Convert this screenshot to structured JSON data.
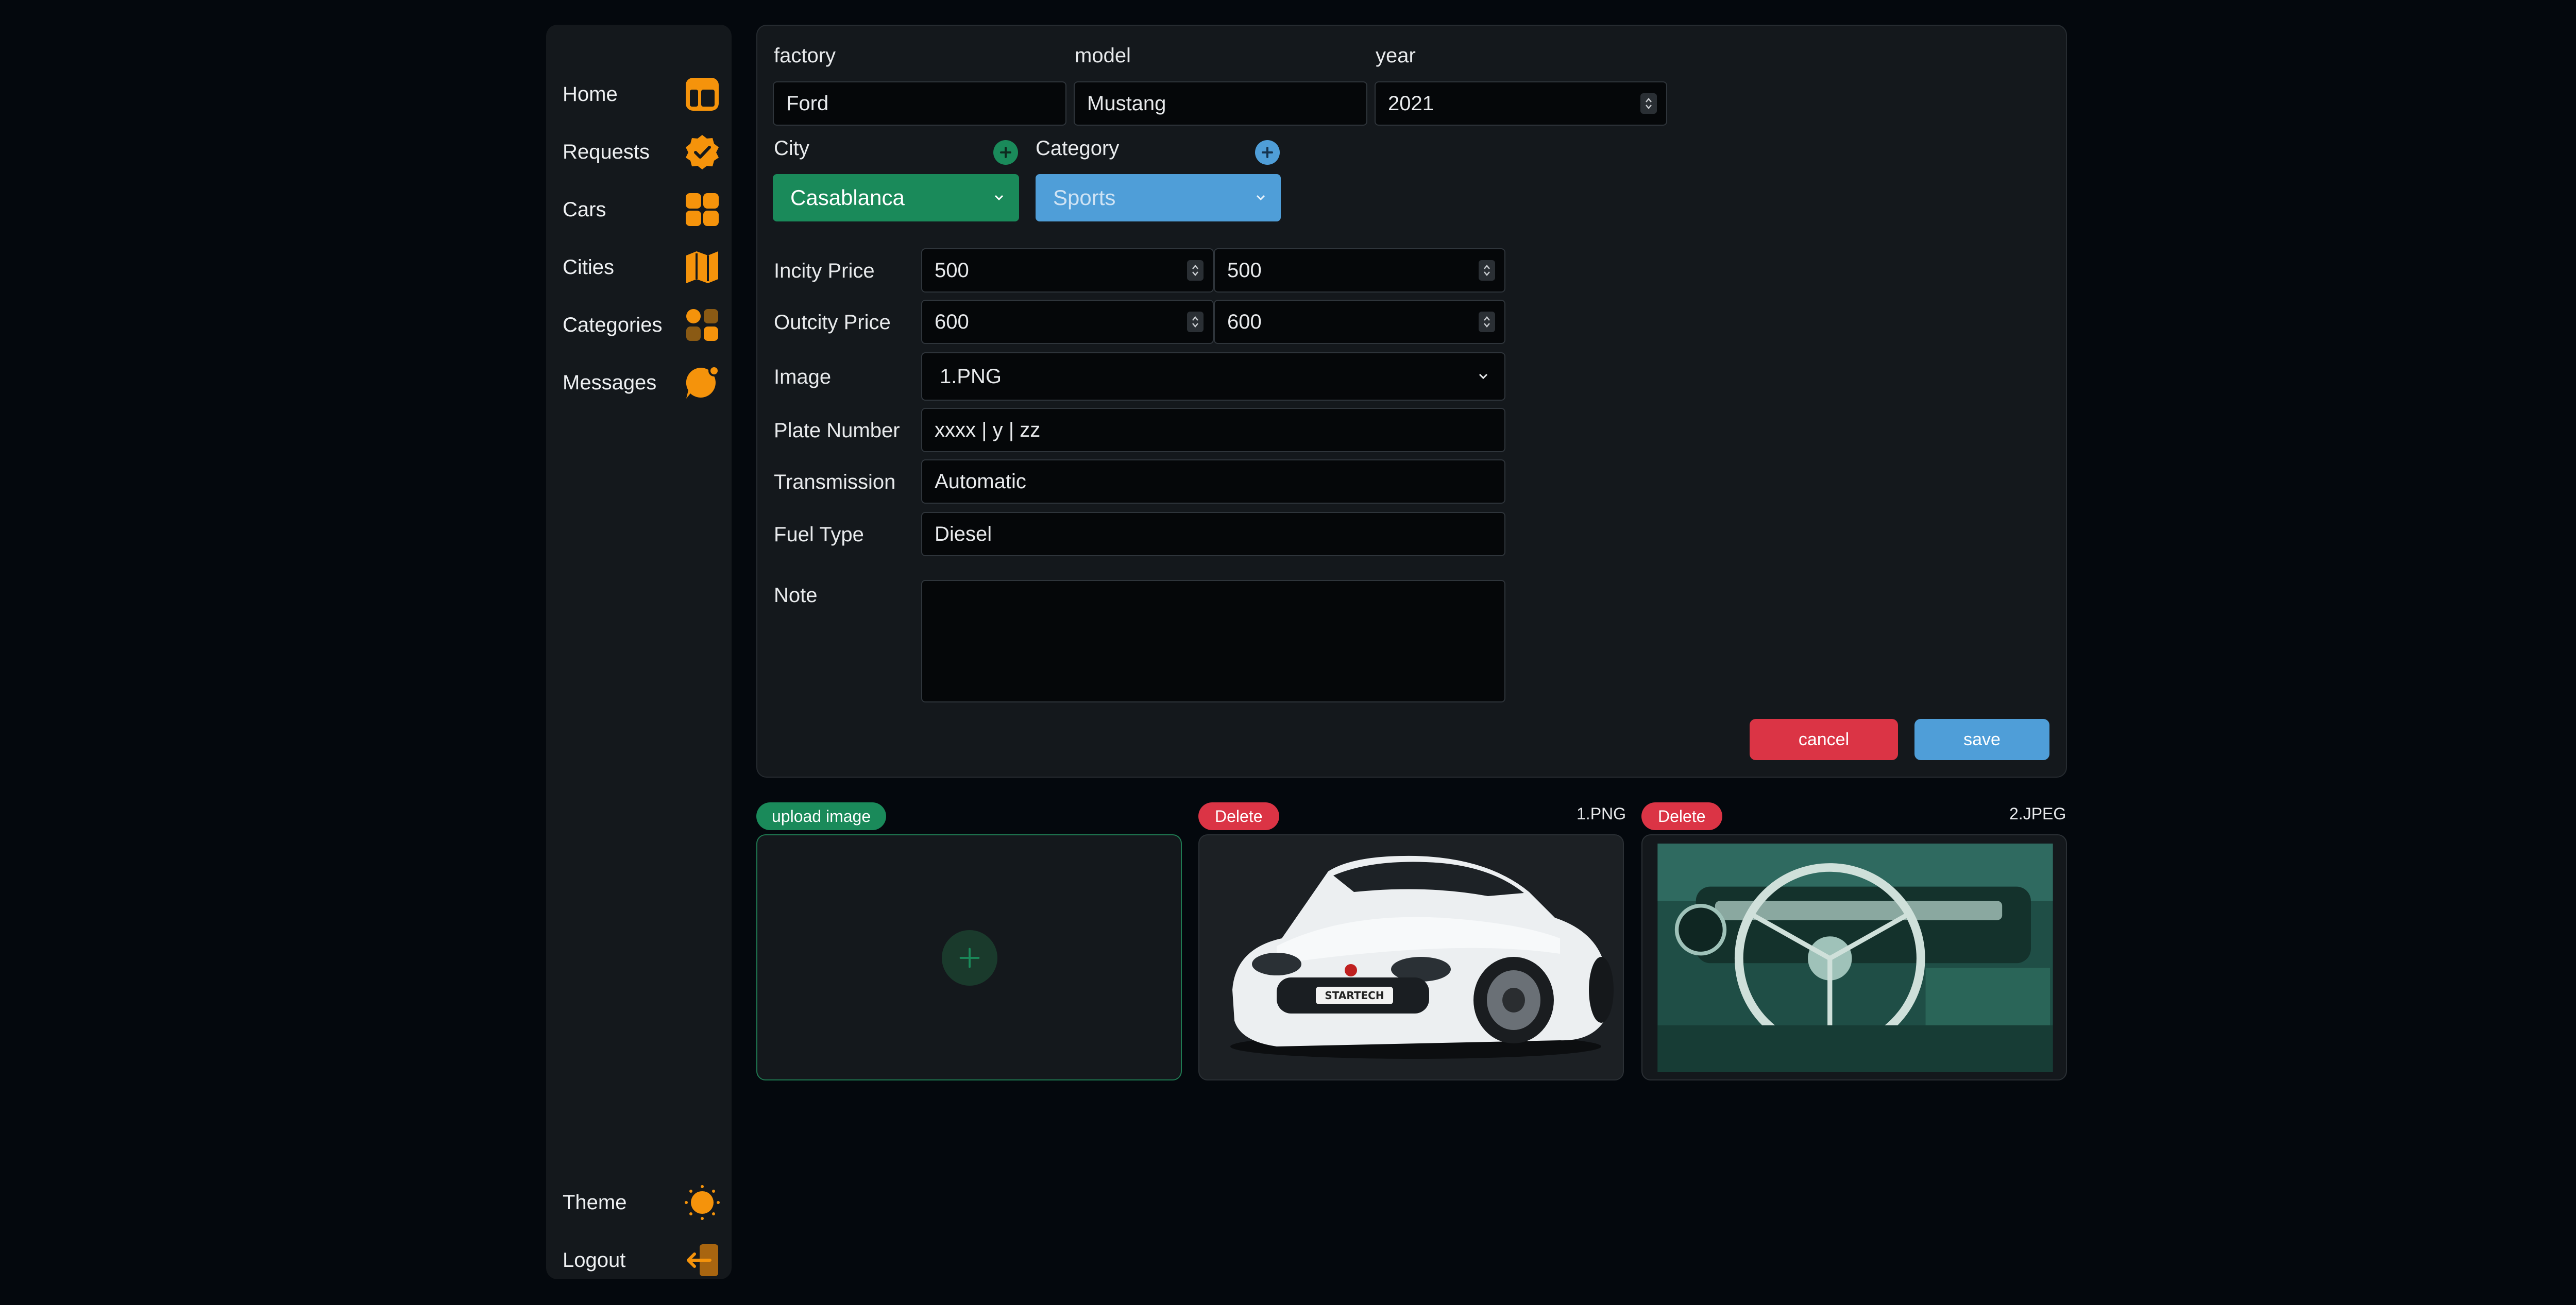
{
  "sidebar": {
    "items": [
      {
        "label": "Home",
        "icon": "layout-icon"
      },
      {
        "label": "Requests",
        "icon": "badge-check-icon"
      },
      {
        "label": "Cars",
        "icon": "grid-icon"
      },
      {
        "label": "Cities",
        "icon": "map-icon"
      },
      {
        "label": "Categories",
        "icon": "categories-icon"
      },
      {
        "label": "Messages",
        "icon": "message-icon"
      }
    ],
    "bottom": [
      {
        "label": "Theme",
        "icon": "sun-icon"
      },
      {
        "label": "Logout",
        "icon": "logout-icon"
      }
    ],
    "accent": "#f5930b"
  },
  "form": {
    "factory": {
      "label": "factory",
      "value": "Ford"
    },
    "model": {
      "label": "model",
      "value": "Mustang"
    },
    "year": {
      "label": "year",
      "value": "2021"
    },
    "city": {
      "label": "City",
      "value": "Casablanca"
    },
    "category": {
      "label": "Category",
      "value": "Sports"
    },
    "incity_price": {
      "label": "Incity Price",
      "min": "500",
      "max": "500"
    },
    "outcity_price": {
      "label": "Outcity Price",
      "min": "600",
      "max": "600"
    },
    "image": {
      "label": "Image",
      "value": "1.PNG"
    },
    "plate_number": {
      "label": "Plate Number",
      "value": "xxxx | y | zz"
    },
    "transmission": {
      "label": "Transmission",
      "value": "Automatic"
    },
    "fuel_type": {
      "label": "Fuel Type",
      "value": "Diesel"
    },
    "note": {
      "label": "Note",
      "value": ""
    },
    "cancel_label": "cancel",
    "save_label": "save"
  },
  "images": {
    "upload_label": "upload image",
    "delete_label": "Delete",
    "files": [
      "1.PNG",
      "2.JPEG"
    ]
  },
  "colors": {
    "green": "#1a8a5a",
    "blue": "#4f9ed8",
    "red": "#db3445"
  }
}
